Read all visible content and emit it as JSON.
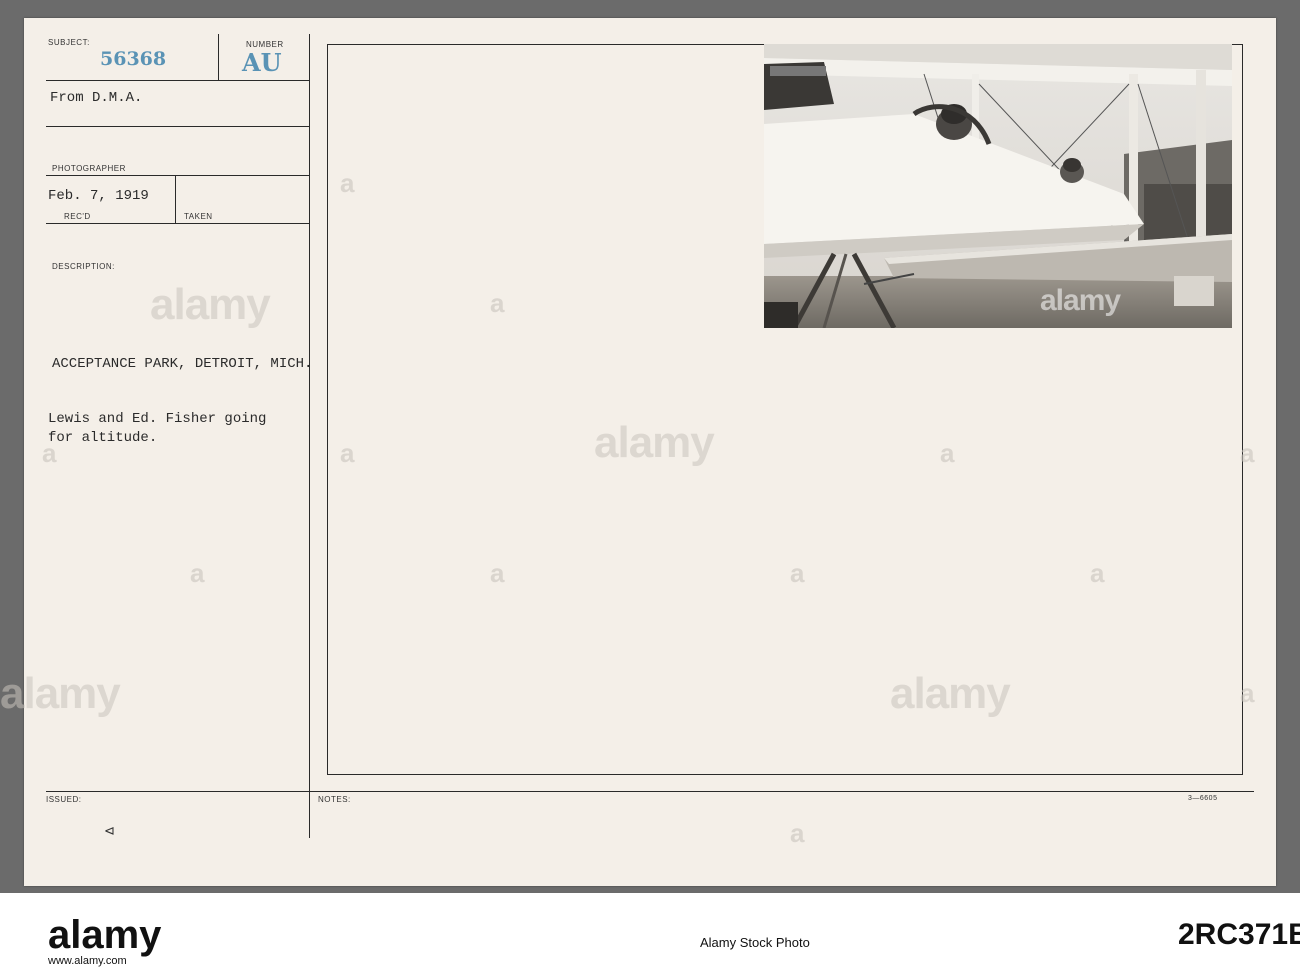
{
  "card": {
    "subject_label": "SUBJECT:",
    "subject_number": "56368",
    "number_label": "NUMBER",
    "number_value": "AU",
    "from_text": "From D.M.A.",
    "photographer_label": "PHOTOGRAPHER",
    "date_text": "Feb. 7, 1919",
    "recd_label": "REC'D",
    "taken_label": "TAKEN",
    "description_label": "DESCRIPTION:",
    "location_text": "ACCEPTANCE PARK, DETROIT, MICH.",
    "caption_line1": "Lewis and Ed. Fisher going",
    "caption_line2": "for altitude.",
    "issued_label": "ISSUED:",
    "notes_label": "NOTES:",
    "form_code": "3—6605",
    "triangle_mark": "⊲"
  },
  "watermark": {
    "text": "alamy",
    "letter": "a"
  },
  "footer": {
    "logo": "alamy",
    "label": "Alamy Stock Photo",
    "site": "www.alamy.com",
    "image_id": "2RC371B"
  },
  "colors": {
    "card": "#f4efe8",
    "stamp": "#5a93b5",
    "backdrop": "#6b6b6b"
  }
}
